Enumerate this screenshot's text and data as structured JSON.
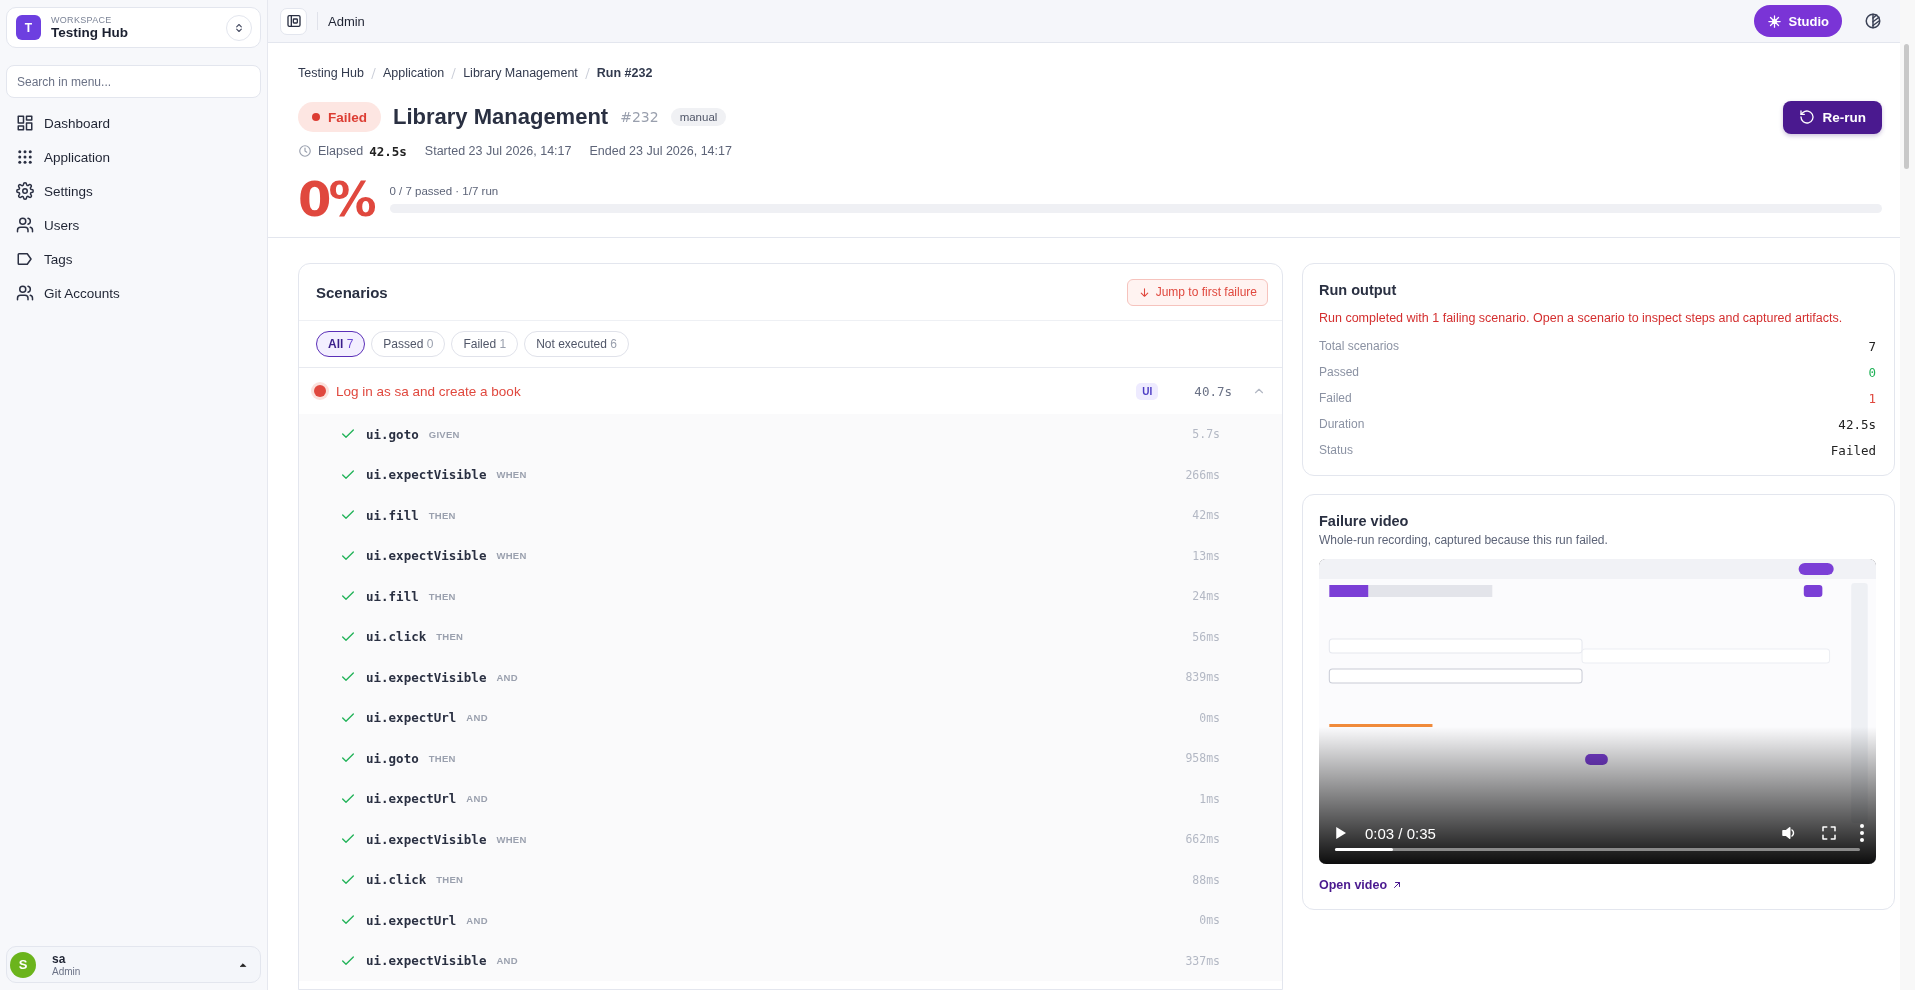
{
  "workspace": {
    "label": "WORKSPACE",
    "name": "Testing Hub",
    "initial": "T"
  },
  "sidebar": {
    "search": {
      "placeholder": "Search in menu..."
    },
    "items": [
      {
        "label": "Dashboard",
        "kind": "dashboard"
      },
      {
        "label": "Application",
        "kind": "grid"
      },
      {
        "label": "Settings",
        "kind": "gear"
      },
      {
        "label": "Users",
        "kind": "users"
      },
      {
        "label": "Tags",
        "kind": "tag"
      },
      {
        "label": "Git Accounts",
        "kind": "users"
      }
    ]
  },
  "user": {
    "initial": "S",
    "name": "sa",
    "role": "Admin"
  },
  "topbar": {
    "title": "Admin",
    "studio": "Studio"
  },
  "breadcrumbs": [
    {
      "label": "Testing Hub",
      "current": false
    },
    {
      "label": "Application",
      "current": false
    },
    {
      "label": "Library Management",
      "current": false
    },
    {
      "label": "Run #232",
      "current": true
    }
  ],
  "run": {
    "failed": true,
    "status_label": "Failed",
    "title": "Library Management",
    "number": "#232",
    "trigger": "manual",
    "elapsed_label": "Elapsed",
    "elapsed": "42.5s",
    "started": "Started 23 Jul 2026, 14:17",
    "ended": "Ended 23 Jul 2026, 14:17",
    "percent": "0%",
    "summary": "0 / 7 passed · 1/7 run",
    "level": 0,
    "rerun": "Re-run"
  },
  "scenarios": {
    "title": "Scenarios",
    "jump": "Jump to first failure",
    "filters": [
      {
        "label": "All",
        "count": "7",
        "selected": true
      },
      {
        "label": "Passed",
        "count": "0",
        "selected": false
      },
      {
        "label": "Failed",
        "count": "1",
        "selected": false
      },
      {
        "label": "Not executed",
        "count": "6",
        "selected": false
      }
    ],
    "items": [
      {
        "name": "Log in as sa and create a book",
        "failed": true,
        "tag": "UI",
        "duration": "40.7s",
        "expanded": true,
        "steps": [
          {
            "action": "ui.goto",
            "keyword": "GIVEN",
            "duration": "5.7s",
            "passed": true
          },
          {
            "action": "ui.expectVisible",
            "keyword": "WHEN",
            "duration": "266ms",
            "passed": true
          },
          {
            "action": "ui.fill",
            "keyword": "THEN",
            "duration": "42ms",
            "passed": true
          },
          {
            "action": "ui.expectVisible",
            "keyword": "WHEN",
            "duration": "13ms",
            "passed": true
          },
          {
            "action": "ui.fill",
            "keyword": "THEN",
            "duration": "24ms",
            "passed": true
          },
          {
            "action": "ui.click",
            "keyword": "THEN",
            "duration": "56ms",
            "passed": true
          },
          {
            "action": "ui.expectVisible",
            "keyword": "AND",
            "duration": "839ms",
            "passed": true
          },
          {
            "action": "ui.expectUrl",
            "keyword": "AND",
            "duration": "0ms",
            "passed": true
          },
          {
            "action": "ui.goto",
            "keyword": "THEN",
            "duration": "958ms",
            "passed": true
          },
          {
            "action": "ui.expectUrl",
            "keyword": "AND",
            "duration": "1ms",
            "passed": true
          },
          {
            "action": "ui.expectVisible",
            "keyword": "WHEN",
            "duration": "662ms",
            "passed": true
          },
          {
            "action": "ui.click",
            "keyword": "THEN",
            "duration": "88ms",
            "passed": true
          },
          {
            "action": "ui.expectUrl",
            "keyword": "AND",
            "duration": "0ms",
            "passed": true
          },
          {
            "action": "ui.expectVisible",
            "keyword": "AND",
            "duration": "337ms",
            "passed": true
          }
        ]
      }
    ]
  },
  "run_output": {
    "title": "Run output",
    "message": "Run completed with 1 failing scenario. Open a scenario to inspect steps and captured artifacts.",
    "stats": [
      {
        "label": "Total scenarios",
        "value": "7",
        "kind": "neutral"
      },
      {
        "label": "Passed",
        "value": "0",
        "kind": "passed"
      },
      {
        "label": "Failed",
        "value": "1",
        "kind": "failed"
      },
      {
        "label": "Duration",
        "value": "42.5s",
        "kind": "neutral"
      },
      {
        "label": "Status",
        "value": "Failed",
        "kind": "neutral"
      }
    ]
  },
  "failure_video": {
    "title": "Failure video",
    "subtitle": "Whole-run recording, captured because this run failed.",
    "video": {
      "time": "0:03 / 0:35",
      "level": 0.11
    },
    "link": "Open video"
  }
}
